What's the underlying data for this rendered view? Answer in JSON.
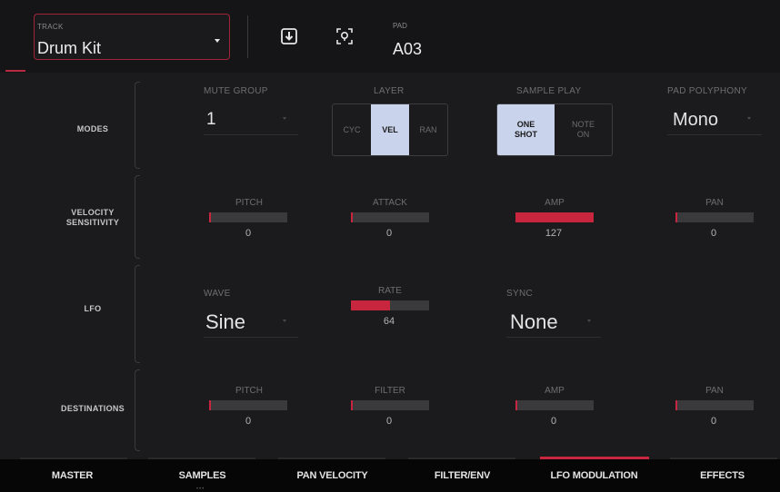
{
  "header": {
    "track_label": "TRACK",
    "track_value": "Drum Kit",
    "pad_label": "PAD",
    "pad_value": "A03",
    "icons": [
      "download-icon",
      "locate-pad-icon"
    ]
  },
  "rows": {
    "modes": "MODES",
    "velocity_line1": "VELOCITY",
    "velocity_line2": "SENSITIVITY",
    "lfo": "LFO",
    "destinations": "DESTINATIONS"
  },
  "modes": {
    "mute_group": {
      "title": "MUTE GROUP",
      "value": "1"
    },
    "layer": {
      "title": "LAYER",
      "options": [
        "CYC",
        "VEL",
        "RAN"
      ],
      "selected": "VEL"
    },
    "sample_play": {
      "title": "SAMPLE PLAY",
      "option1_line1": "ONE",
      "option1_line2": "SHOT",
      "option2_line1": "NOTE",
      "option2_line2": "ON",
      "selected": "ONE SHOT"
    },
    "pad_polyphony": {
      "title": "PAD POLYPHONY",
      "value": "Mono"
    }
  },
  "velocity_sensitivity": {
    "pitch": {
      "title": "PITCH",
      "value": "0",
      "fraction": 0
    },
    "attack": {
      "title": "ATTACK",
      "value": "0",
      "fraction": 0
    },
    "amp": {
      "title": "AMP",
      "value": "127",
      "fraction": 1.0
    },
    "pan": {
      "title": "PAN",
      "value": "0",
      "fraction": 0
    }
  },
  "lfo": {
    "wave": {
      "title": "WAVE",
      "value": "Sine"
    },
    "rate": {
      "title": "RATE",
      "value": "64",
      "fraction": 0.5
    },
    "sync": {
      "title": "SYNC",
      "value": "None"
    }
  },
  "destinations": {
    "pitch": {
      "title": "PITCH",
      "value": "0",
      "fraction": 0
    },
    "filter": {
      "title": "FILTER",
      "value": "0",
      "fraction": 0
    },
    "amp": {
      "title": "AMP",
      "value": "0",
      "fraction": 0
    },
    "pan": {
      "title": "PAN",
      "value": "0",
      "fraction": 0
    }
  },
  "tabs": [
    "MASTER",
    "SAMPLES",
    "PAN VELOCITY",
    "FILTER/ENV",
    "LFO MODULATION",
    "EFFECTS"
  ],
  "active_tab": "LFO MODULATION",
  "colors": {
    "accent": "#c8253f",
    "selected": "#c9d3eb",
    "background": "#1b1b1d"
  }
}
